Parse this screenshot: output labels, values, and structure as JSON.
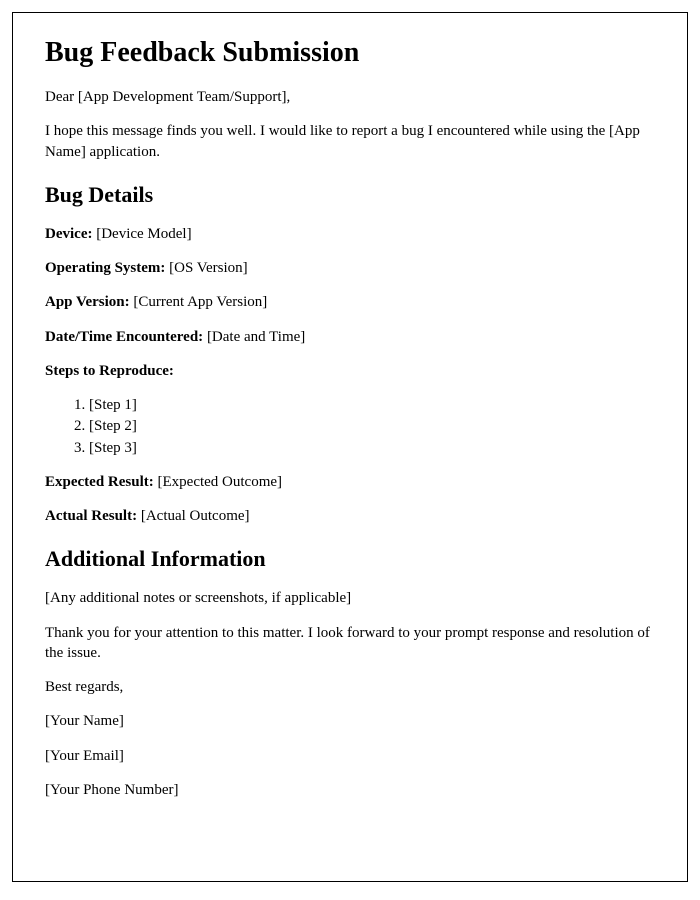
{
  "title": "Bug Feedback Submission",
  "greeting": "Dear [App Development Team/Support],",
  "intro": "I hope this message finds you well. I would like to report a bug I encountered while using the [App Name] application.",
  "section_bug_details": "Bug Details",
  "fields": {
    "device_label": "Device:",
    "device_value": " [Device Model]",
    "os_label": "Operating System:",
    "os_value": " [OS Version]",
    "app_version_label": "App Version:",
    "app_version_value": " [Current App Version]",
    "datetime_label": "Date/Time Encountered:",
    "datetime_value": " [Date and Time]",
    "steps_label": "Steps to Reproduce:",
    "step1": "[Step 1]",
    "step2": "[Step 2]",
    "step3": "[Step 3]",
    "expected_label": "Expected Result:",
    "expected_value": " [Expected Outcome]",
    "actual_label": "Actual Result:",
    "actual_value": " [Actual Outcome]"
  },
  "section_additional": "Additional Information",
  "additional_notes": "[Any additional notes or screenshots, if applicable]",
  "closing": "Thank you for your attention to this matter. I look forward to your prompt response and resolution of the issue.",
  "signoff": "Best regards,",
  "your_name": "[Your Name]",
  "your_email": "[Your Email]",
  "your_phone": "[Your Phone Number]"
}
